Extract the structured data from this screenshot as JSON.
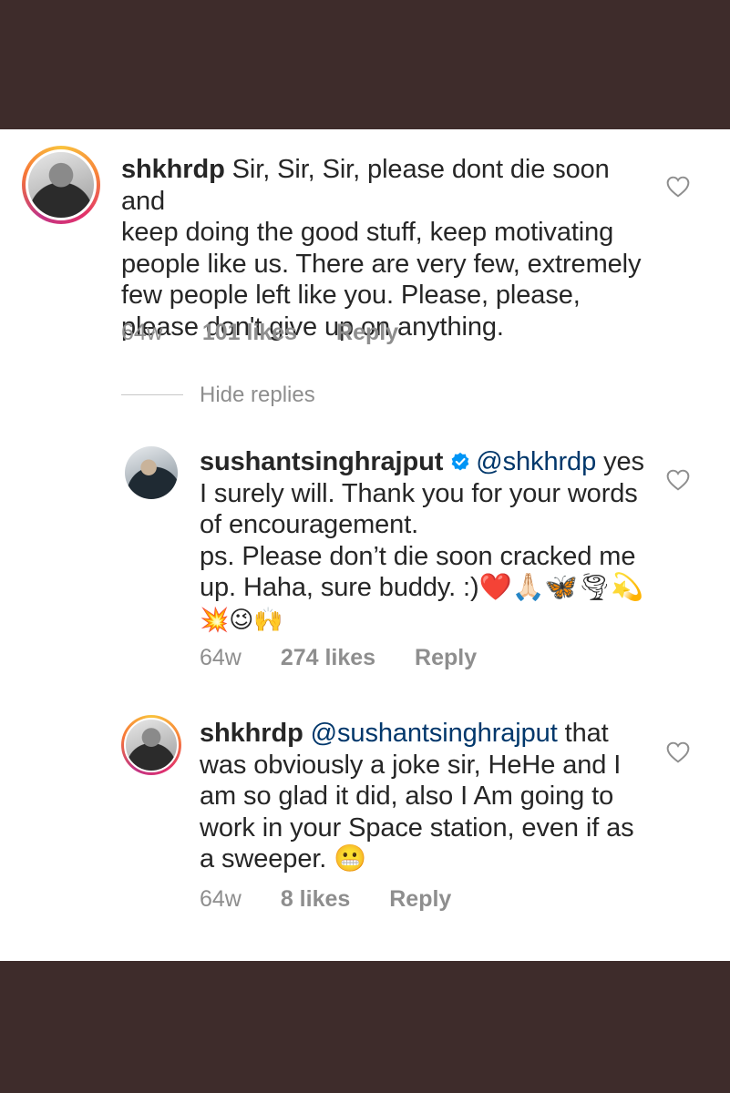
{
  "comments": [
    {
      "username": "shkhrdp",
      "text": "Sir, Sir, Sir, please dont die soon and keep doing the good stuff, keep motivating people like us. There are very few, extremely few people left like you. Please, please, please don't give up on anything.",
      "lines": [
        "Sir, Sir, Sir, please dont die soon and",
        "keep doing the good stuff, keep motivating",
        "people like us. There are very few, extremely",
        "few people left like you. Please, please,",
        "please don't give up on anything."
      ],
      "age": "64w",
      "likes": "101 likes",
      "reply_label": "Reply"
    },
    {
      "username": "sushantsinghrajput",
      "verified": true,
      "mention": "@shkhrdp",
      "lines": [
        "yes",
        "I surely will. Thank you for your words",
        "of encouragement.",
        "ps. Please don’t die soon cracked me",
        "up. Haha, sure buddy. :)❤️🙏🏻🦋🌪💫",
        "💥😉🙌"
      ],
      "age": "64w",
      "likes": "274 likes",
      "reply_label": "Reply"
    },
    {
      "username": "shkhrdp",
      "mention": "@sushantsinghrajput",
      "lines": [
        "that",
        "was obviously a joke sir, HeHe and I",
        "am so glad it did, also I Am going to",
        "work in your Space station, even if as",
        "a sweeper. 😬"
      ],
      "age": "64w",
      "likes": "8 likes",
      "reply_label": "Reply"
    }
  ],
  "hide_replies_label": "Hide replies",
  "colors": {
    "background": "#3e2c2b",
    "panel": "#ffffff",
    "text": "#262626",
    "meta": "#8e8e8e",
    "mention": "#00376b",
    "verified": "#0095f6"
  },
  "icons": {
    "like": "heart-outline-icon",
    "verified": "verified-badge-icon"
  }
}
